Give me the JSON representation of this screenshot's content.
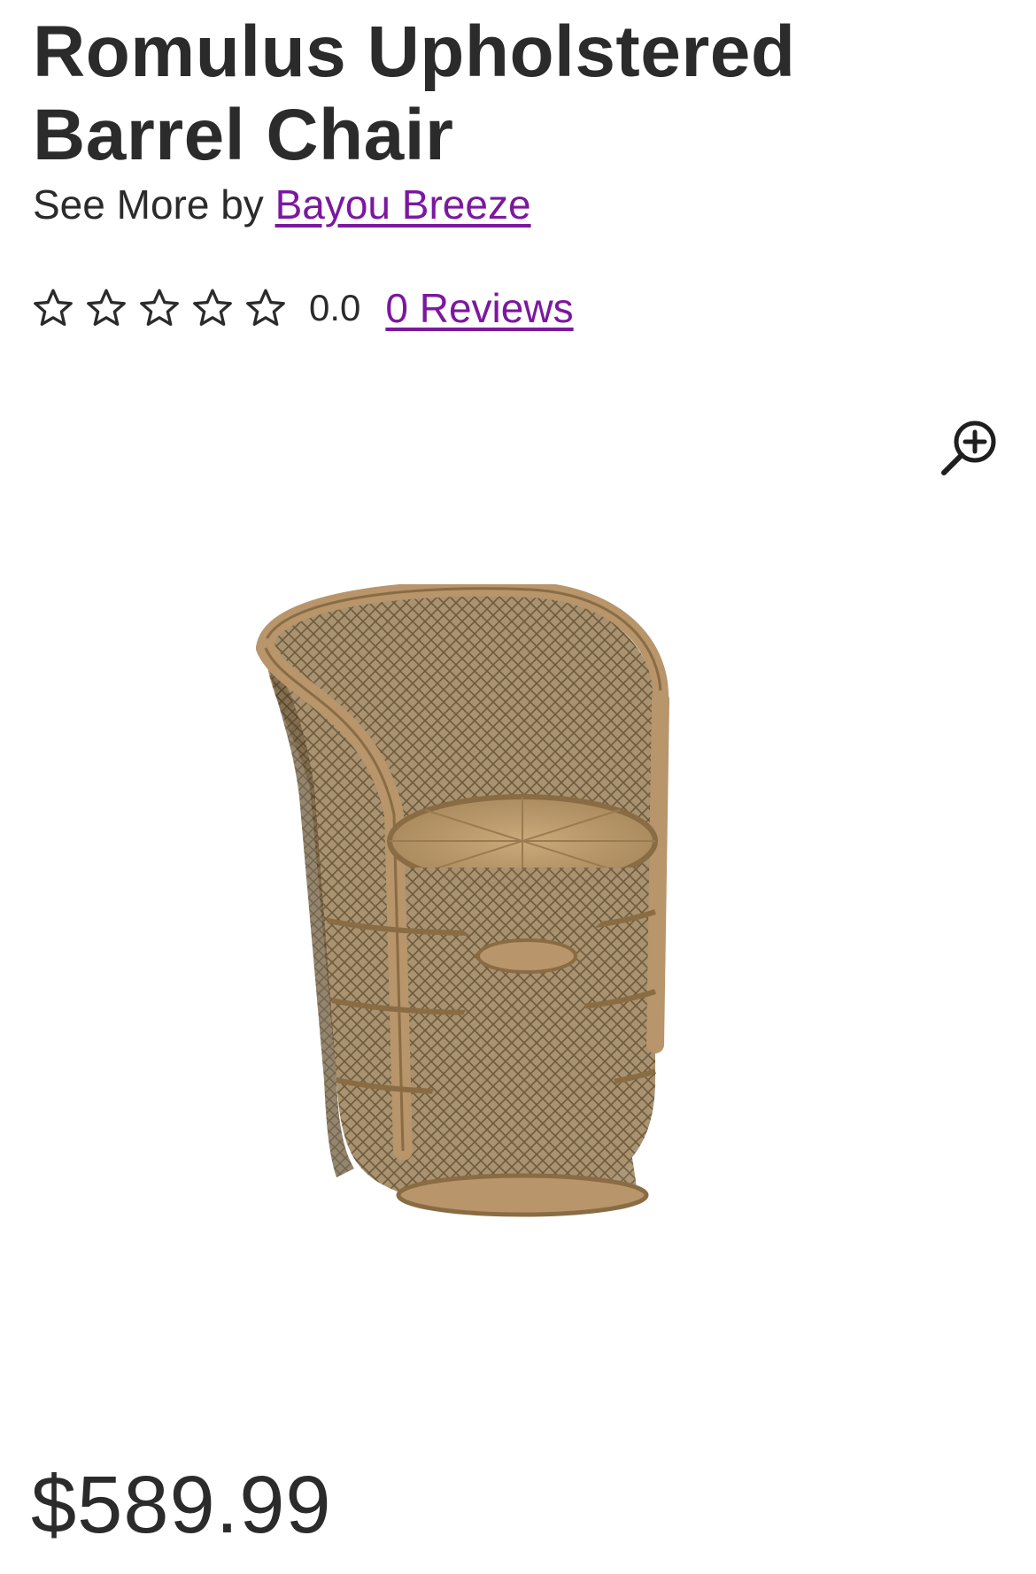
{
  "product": {
    "title": "Romulus Upholstered Barrel Chair",
    "see_more_prefix": "See More by",
    "brand": "Bayou Breeze",
    "rating_value": "0.0",
    "rating_stars": 0,
    "rating_max": 5,
    "reviews_label": "0 Reviews",
    "price": "$589.99",
    "image_alt": "wicker barrel chair"
  },
  "icons": {
    "star": "star-outline-icon",
    "zoom": "zoom-in-icon"
  },
  "colors": {
    "text": "#2b2b2b",
    "link": "#7b189f",
    "background": "#ffffff"
  }
}
